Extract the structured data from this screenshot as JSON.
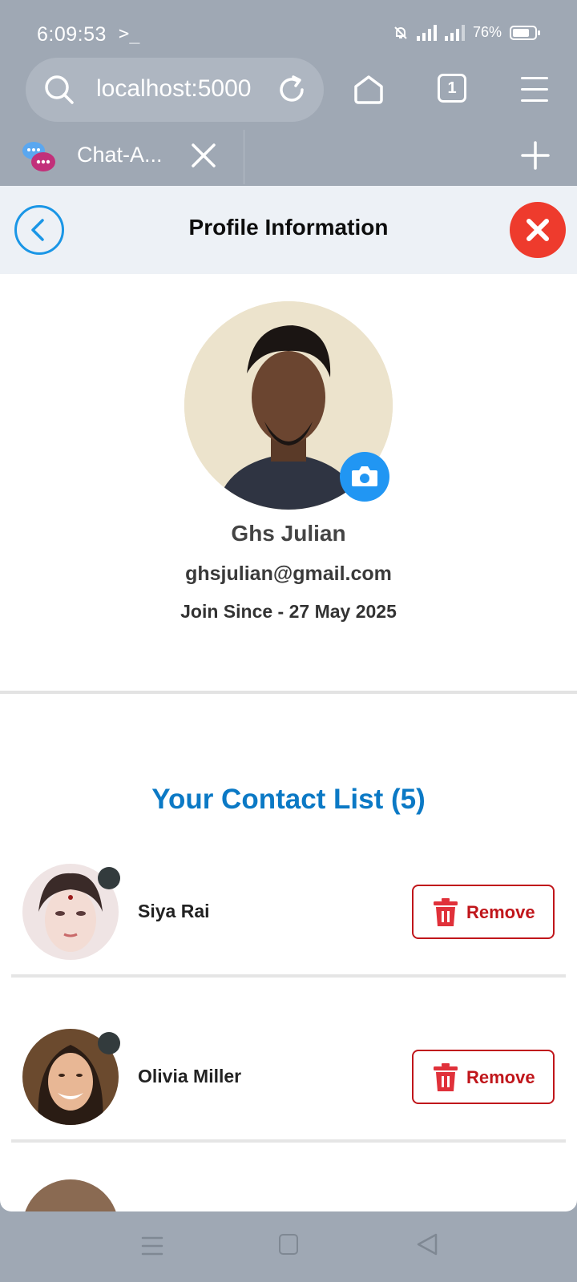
{
  "status_bar": {
    "time": "6:09:53",
    "terminal_glyph": ">_",
    "battery": "76%"
  },
  "browser": {
    "url": "localhost:5000",
    "tab_count": "1",
    "tab_title": "Chat-A..."
  },
  "header": {
    "title": "Profile Information"
  },
  "profile": {
    "name": "Ghs Julian",
    "email": "ghsjulian@gmail.com",
    "joined": "Join Since - 27 May 2025"
  },
  "contacts": {
    "title": "Your Contact List (5)",
    "remove_label": "Remove",
    "items": [
      {
        "name": "Siya Rai",
        "remove_label": "Remove"
      },
      {
        "name": "Olivia Miller",
        "remove_label": "Remove"
      }
    ]
  },
  "colors": {
    "accent_blue": "#0b79c5",
    "danger_red": "#c0161b",
    "close_red": "#ee3b2d",
    "camera_blue": "#2196f3"
  }
}
